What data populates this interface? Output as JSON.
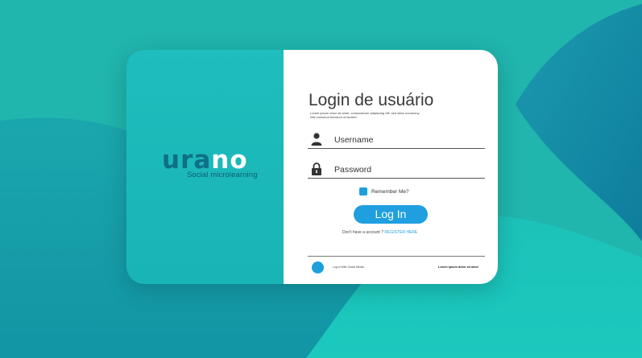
{
  "brand": {
    "logo_part1": "ura",
    "logo_part2": "no",
    "tagline": "Social microlearning"
  },
  "login": {
    "title": "Login de usuário",
    "subtitle": "Lorem ipsum dolor sit amet, consectetuer adipiscing elit, sed diam nonummy nibh euismod tincidunt ut laoreet.",
    "username_placeholder": "Username",
    "password_placeholder": "Password",
    "remember_label": "Remember Me?",
    "login_button": "Log In",
    "no_account_text": "Don't have a account ?",
    "register_link": "REGISTER HERE",
    "social_label": "Log in With Social Media",
    "footer_text": "Lorem ipsum dolor sit amet"
  },
  "icons": {
    "user": "user-icon",
    "lock": "lock-icon",
    "social": "social-media-icon"
  },
  "colors": {
    "accent": "#1f9fe0",
    "brand_teal": "#1fbdbd",
    "brand_dark": "#0f6f86"
  }
}
